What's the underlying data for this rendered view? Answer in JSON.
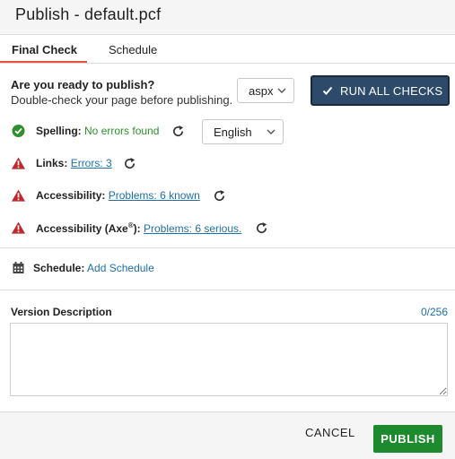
{
  "dialog": {
    "title": "Publish - default.pcf"
  },
  "tabs": [
    {
      "label": "Final Check",
      "active": true
    },
    {
      "label": "Schedule",
      "active": false
    }
  ],
  "ready": {
    "question": "Are you ready to publish?",
    "subtitle": "Double-check your page before publishing.",
    "extension_select": "aspx",
    "run_button": "RUN ALL CHECKS"
  },
  "checks": {
    "spelling": {
      "label": "Spelling:",
      "result": "No errors found",
      "language": "English",
      "status": "ok"
    },
    "links": {
      "label": "Links:",
      "result": "Errors: 3",
      "status": "warning"
    },
    "accessibility": {
      "label": "Accessibility:",
      "result": "Problems: 6 known",
      "status": "warning"
    },
    "axe": {
      "label": "Accessibility (Axe",
      "sup": "®",
      "suffix": "):",
      "result": "Problems: 6 serious.",
      "status": "warning"
    }
  },
  "schedule": {
    "label": "Schedule:",
    "action": "Add Schedule"
  },
  "version": {
    "label": "Version Description",
    "count": "0/256",
    "value": ""
  },
  "footer": {
    "cancel": "CANCEL",
    "publish": "PUBLISH"
  },
  "colors": {
    "accent_tab": "#e8533f",
    "run_button_bg": "#2e4a6b",
    "ok_green": "#2f8f2f",
    "warning_red": "#c0282d",
    "link_blue": "#1e6fa8",
    "publish_green": "#1e8a2e"
  },
  "icons": {
    "spelling": "check-circle-icon",
    "warning": "warning-triangle-icon",
    "refresh": "refresh-icon",
    "schedule": "calendar-icon"
  }
}
